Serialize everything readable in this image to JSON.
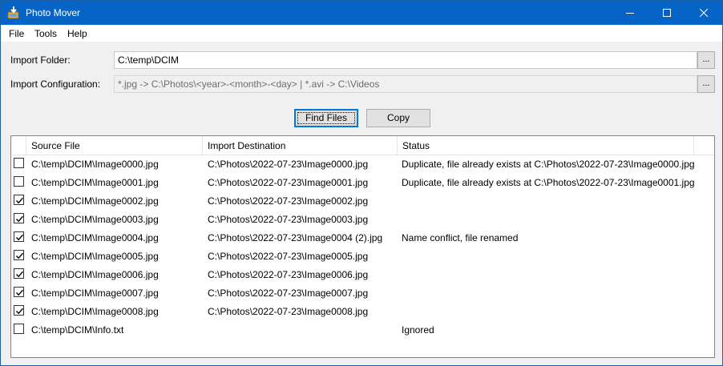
{
  "window": {
    "title": "Photo Mover",
    "accent_color": "#0764c7"
  },
  "menu": {
    "items": [
      "File",
      "Tools",
      "Help"
    ]
  },
  "form": {
    "import_folder_label": "Import Folder:",
    "import_folder_value": "C:\\temp\\DCIM",
    "import_config_label": "Import Configuration:",
    "import_config_value": "*.jpg -> C:\\Photos\\<year>-<month>-<day> | *.avi -> C:\\Videos",
    "browse_label": "..."
  },
  "buttons": {
    "find_files": "Find Files",
    "copy": "Copy"
  },
  "list": {
    "columns": [
      "Source File",
      "Import Destination",
      "Status"
    ],
    "rows": [
      {
        "checked": false,
        "source": "C:\\temp\\DCIM\\Image0000.jpg",
        "destination": "C:\\Photos\\2022-07-23\\Image0000.jpg",
        "status": "Duplicate, file already exists at C:\\Photos\\2022-07-23\\Image0000.jpg"
      },
      {
        "checked": false,
        "source": "C:\\temp\\DCIM\\Image0001.jpg",
        "destination": "C:\\Photos\\2022-07-23\\Image0001.jpg",
        "status": "Duplicate, file already exists at C:\\Photos\\2022-07-23\\Image0001.jpg"
      },
      {
        "checked": true,
        "source": "C:\\temp\\DCIM\\Image0002.jpg",
        "destination": "C:\\Photos\\2022-07-23\\Image0002.jpg",
        "status": ""
      },
      {
        "checked": true,
        "source": "C:\\temp\\DCIM\\Image0003.jpg",
        "destination": "C:\\Photos\\2022-07-23\\Image0003.jpg",
        "status": ""
      },
      {
        "checked": true,
        "source": "C:\\temp\\DCIM\\Image0004.jpg",
        "destination": "C:\\Photos\\2022-07-23\\Image0004 (2).jpg",
        "status": "Name conflict, file renamed"
      },
      {
        "checked": true,
        "source": "C:\\temp\\DCIM\\Image0005.jpg",
        "destination": "C:\\Photos\\2022-07-23\\Image0005.jpg",
        "status": ""
      },
      {
        "checked": true,
        "source": "C:\\temp\\DCIM\\Image0006.jpg",
        "destination": "C:\\Photos\\2022-07-23\\Image0006.jpg",
        "status": ""
      },
      {
        "checked": true,
        "source": "C:\\temp\\DCIM\\Image0007.jpg",
        "destination": "C:\\Photos\\2022-07-23\\Image0007.jpg",
        "status": ""
      },
      {
        "checked": true,
        "source": "C:\\temp\\DCIM\\Image0008.jpg",
        "destination": "C:\\Photos\\2022-07-23\\Image0008.jpg",
        "status": ""
      },
      {
        "checked": false,
        "source": "C:\\temp\\DCIM\\Info.txt",
        "destination": "",
        "status": "Ignored"
      }
    ]
  }
}
